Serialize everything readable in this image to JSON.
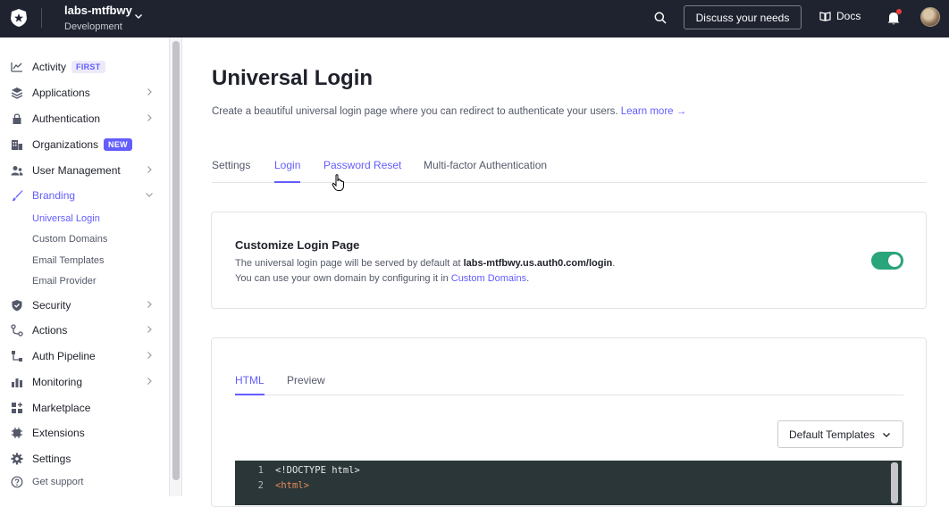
{
  "header": {
    "tenant_name": "labs-mtfbwy",
    "tenant_env": "Development",
    "discuss_label": "Discuss your needs",
    "docs_label": "Docs"
  },
  "sidebar": {
    "items": [
      {
        "label": "Activity",
        "badge": "FIRST",
        "icon": "activity-icon"
      },
      {
        "label": "Applications",
        "icon": "applications-icon"
      },
      {
        "label": "Authentication",
        "icon": "lock-icon"
      },
      {
        "label": "Organizations",
        "badge": "NEW",
        "icon": "organizations-icon"
      },
      {
        "label": "User Management",
        "icon": "users-icon"
      },
      {
        "label": "Branding",
        "icon": "brush-icon"
      },
      {
        "label": "Security",
        "icon": "shield-icon"
      },
      {
        "label": "Actions",
        "icon": "actions-icon"
      },
      {
        "label": "Auth Pipeline",
        "icon": "pipeline-icon"
      },
      {
        "label": "Monitoring",
        "icon": "chart-icon"
      },
      {
        "label": "Marketplace",
        "icon": "marketplace-icon"
      },
      {
        "label": "Extensions",
        "icon": "extensions-icon"
      },
      {
        "label": "Settings",
        "icon": "gear-icon"
      },
      {
        "label": "Get support",
        "icon": "help-icon"
      }
    ],
    "branding_sub": [
      "Universal Login",
      "Custom Domains",
      "Email Templates",
      "Email Provider"
    ]
  },
  "main": {
    "title": "Universal Login",
    "description": "Create a beautiful universal login page where you can redirect to authenticate your users.",
    "learn_more": "Learn more →",
    "tabs": [
      "Settings",
      "Login",
      "Password Reset",
      "Multi-factor Authentication"
    ],
    "active_tab": "Login"
  },
  "customize": {
    "title": "Customize Login Page",
    "line1_prefix": "The universal login page will be served by default at ",
    "line1_domain": "labs-mtfbwy.us.auth0.com/login",
    "line1_suffix": ".",
    "line2_prefix": "You can use your own domain by configuring it in ",
    "line2_link": "Custom Domains",
    "line2_suffix": ".",
    "toggle_on": true
  },
  "editor_card": {
    "tabs": [
      "HTML",
      "Preview"
    ],
    "active_tab": "HTML",
    "template_select": "Default Templates",
    "code_lines": [
      {
        "num": "1",
        "text": "<!DOCTYPE html>",
        "color": "#e8e8e8"
      },
      {
        "num": "2",
        "text": "<html>",
        "color": "#e88a5d"
      }
    ]
  },
  "colors": {
    "accent": "#635dff",
    "topbar": "#1f2330",
    "toggle": "#2aa47a"
  }
}
